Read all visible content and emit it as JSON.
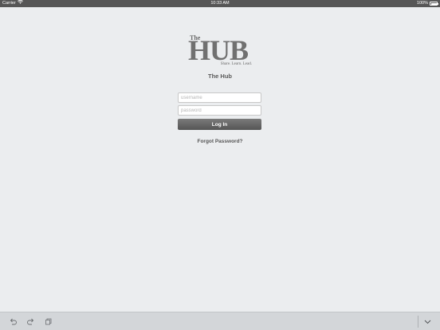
{
  "status_bar": {
    "carrier": "Carrier",
    "time": "10:33 AM",
    "battery": "100%",
    "icons": [
      "wifi-icon",
      "battery-icon"
    ]
  },
  "logo": {
    "the": "The",
    "hub": "HUB",
    "tagline": "Share. Learn. Lead."
  },
  "app": {
    "title": "The Hub"
  },
  "form": {
    "username_placeholder": "username",
    "username_value": "",
    "password_placeholder": "password",
    "password_value": "",
    "login_label": "Log In",
    "forgot_label": "Forgot Password?"
  },
  "toolbar": {
    "icons": [
      "undo-icon",
      "redo-icon",
      "clipboard-icon",
      "chevron-down-icon"
    ]
  },
  "colors": {
    "background": "#ebedef",
    "status_bar": "#565656",
    "button": "#666666",
    "toolbar": "#d3d6d9"
  }
}
